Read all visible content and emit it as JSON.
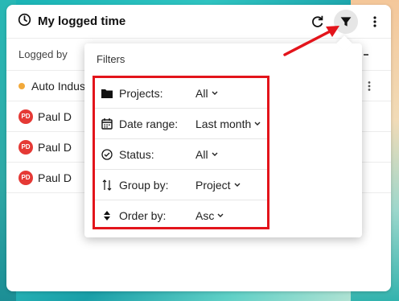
{
  "card": {
    "title": "My logged time",
    "column_header": "Logged by",
    "rows": [
      {
        "label": "Auto Indus",
        "type": "group"
      },
      {
        "label": "Paul D",
        "avatar": "PD"
      },
      {
        "label": "Paul D",
        "avatar": "PD"
      },
      {
        "label": "Paul D",
        "avatar": "PD"
      }
    ]
  },
  "filters": {
    "title": "Filters",
    "items": [
      {
        "label": "Projects:",
        "value": "All",
        "icon": "folder-icon"
      },
      {
        "label": "Date range:",
        "value": "Last month",
        "icon": "calendar-icon"
      },
      {
        "label": "Status:",
        "value": "All",
        "icon": "check-circle-icon"
      },
      {
        "label": "Group by:",
        "value": "Project",
        "icon": "sort-arrows-icon"
      },
      {
        "label": "Order by:",
        "value": "Asc",
        "icon": "order-icon"
      }
    ]
  },
  "colors": {
    "highlight": "#e3141b",
    "avatar": "#e53935",
    "group_dot": "#f2a93b"
  }
}
